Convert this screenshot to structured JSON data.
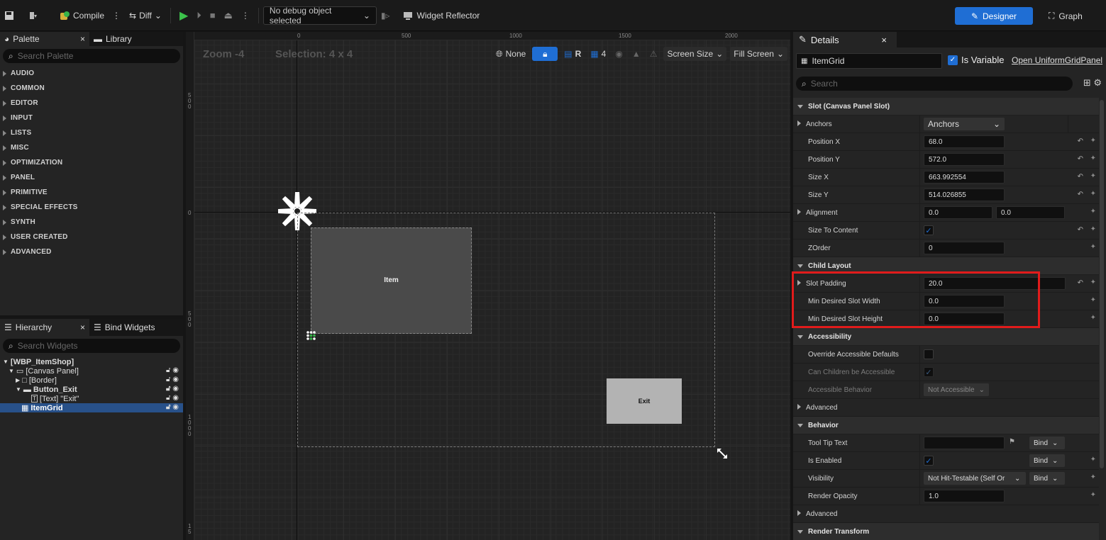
{
  "toolbar": {
    "compile": "Compile",
    "diff": "Diff",
    "debug_object": "No debug object selected",
    "widget_reflector": "Widget Reflector",
    "designer": "Designer",
    "graph": "Graph"
  },
  "palette": {
    "tab_palette": "Palette",
    "tab_library": "Library",
    "search_placeholder": "Search Palette",
    "categories": [
      "AUDIO",
      "COMMON",
      "EDITOR",
      "INPUT",
      "LISTS",
      "MISC",
      "OPTIMIZATION",
      "PANEL",
      "PRIMITIVE",
      "SPECIAL EFFECTS",
      "SYNTH",
      "USER CREATED",
      "ADVANCED"
    ]
  },
  "hierarchy": {
    "tab_hierarchy": "Hierarchy",
    "tab_bind": "Bind Widgets",
    "search_placeholder": "Search Widgets",
    "items": [
      "[WBP_ItemShop]",
      "[Canvas Panel]",
      "[Border]",
      "Button_Exit",
      "[Text] \"Exit\"",
      "ItemGrid"
    ]
  },
  "canvas": {
    "zoom": "Zoom -4",
    "selection": "Selection: 4 x 4",
    "ruler_top": [
      "0",
      "500",
      "1000",
      "1500",
      "2000"
    ],
    "none_label": "None",
    "r_label": "R",
    "grid_num": "4",
    "screen_size": "Screen Size",
    "fill_screen": "Fill Screen",
    "item_label": "Item",
    "exit_label": "Exit"
  },
  "details": {
    "tab": "Details",
    "widget_name": "ItemGrid",
    "is_variable": "Is Variable",
    "open_link": "Open UniformGridPanel",
    "search_placeholder": "Search",
    "sections": {
      "slot": "Slot (Canvas Panel Slot)",
      "child_layout": "Child Layout",
      "accessibility": "Accessibility",
      "behavior": "Behavior",
      "render_transform": "Render Transform"
    },
    "slot": {
      "anchors_label": "Anchors",
      "anchors_value": "Anchors",
      "pos_x_label": "Position X",
      "pos_x": "68.0",
      "pos_y_label": "Position Y",
      "pos_y": "572.0",
      "size_x_label": "Size X",
      "size_x": "663.992554",
      "size_y_label": "Size Y",
      "size_y": "514.026855",
      "alignment_label": "Alignment",
      "align_x": "0.0",
      "align_y": "0.0",
      "size_to_content_label": "Size To Content",
      "zorder_label": "ZOrder",
      "zorder": "0"
    },
    "child_layout": {
      "slot_padding_label": "Slot Padding",
      "slot_padding": "20.0",
      "min_w_label": "Min Desired Slot Width",
      "min_w": "0.0",
      "min_h_label": "Min Desired Slot Height",
      "min_h": "0.0"
    },
    "accessibility": {
      "override_label": "Override Accessible Defaults",
      "children_label": "Can Children be Accessible",
      "behavior_label": "Accessible Behavior",
      "behavior_value": "Not Accessible",
      "advanced_label": "Advanced"
    },
    "behavior": {
      "tooltip_label": "Tool Tip Text",
      "bind": "Bind",
      "enabled_label": "Is Enabled",
      "visibility_label": "Visibility",
      "visibility_value": "Not Hit-Testable (Self Or",
      "opacity_label": "Render Opacity",
      "opacity": "1.0",
      "advanced_label": "Advanced"
    }
  },
  "colors": {
    "accent": "#1f6ed4",
    "highlight": "#e11b1b"
  }
}
